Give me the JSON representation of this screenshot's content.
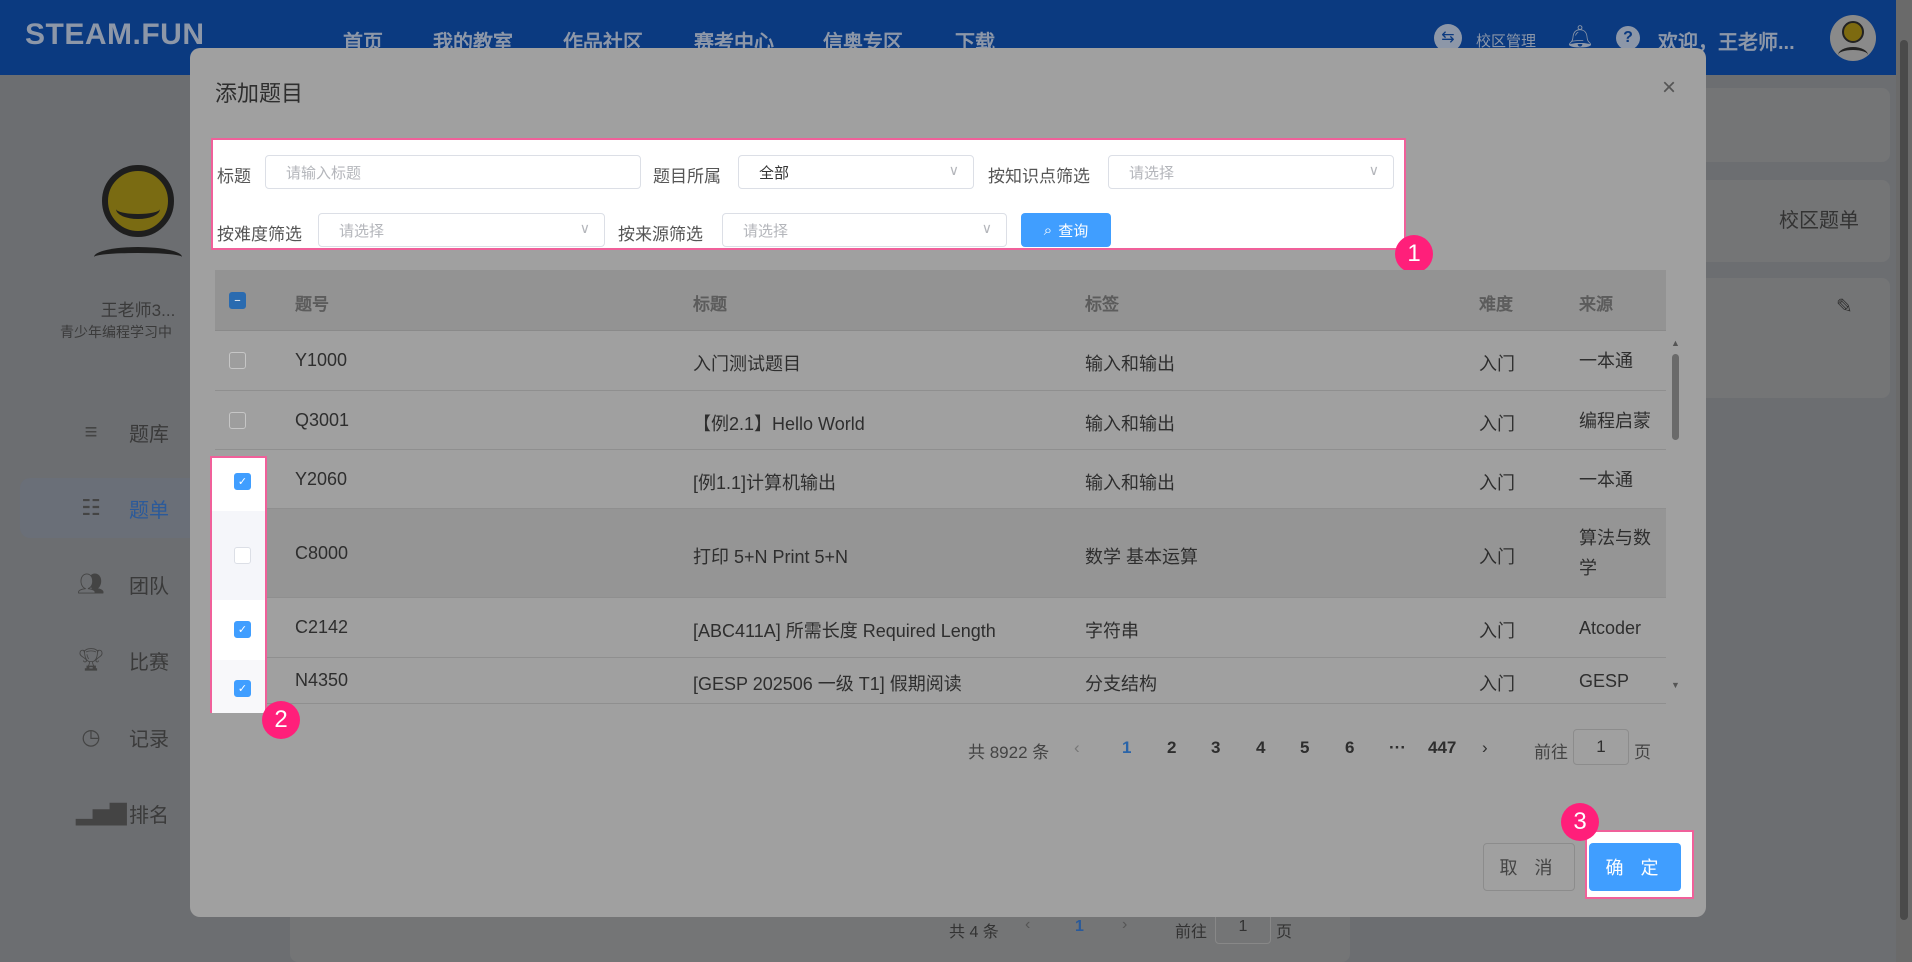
{
  "header": {
    "logo": "STEAM.FUN",
    "nav": [
      "首页",
      "我的教室",
      "作品社区",
      "赛考中心",
      "信奥专区",
      "下载"
    ],
    "campus_admin": "校区管理",
    "welcome": "欢迎，王老师..."
  },
  "sidebar": {
    "name": "王老师3...",
    "subtitle": "青少年编程学习中",
    "items": [
      {
        "label": "题库",
        "icon": "edit-list-icon"
      },
      {
        "label": "题单",
        "icon": "clipboard-list-icon"
      },
      {
        "label": "团队",
        "icon": "users-icon"
      },
      {
        "label": "比赛",
        "icon": "trophy-icon"
      },
      {
        "label": "记录",
        "icon": "clock-icon"
      },
      {
        "label": "排名",
        "icon": "bar-chart-icon"
      }
    ],
    "active": "题单"
  },
  "background": {
    "campus_list": "校区题单",
    "pagination": {
      "total": "共 4 条",
      "current": "1",
      "goto": "前往",
      "goto_value": "1",
      "page_suffix": "页"
    }
  },
  "modal": {
    "title": "添加题目",
    "filters": {
      "title_label": "标题",
      "title_placeholder": "请输入标题",
      "belong_label": "题目所属",
      "belong_value": "全部",
      "knowledge_label": "按知识点筛选",
      "knowledge_placeholder": "请选择",
      "difficulty_label": "按难度筛选",
      "difficulty_placeholder": "请选择",
      "source_label": "按来源筛选",
      "source_placeholder": "请选择",
      "search_button": "查询"
    },
    "table": {
      "columns": [
        "题号",
        "标题",
        "标签",
        "难度",
        "来源"
      ],
      "rows": [
        {
          "id": "Y1000",
          "title": "入门测试题目",
          "tags": "输入和输出",
          "difficulty": "入门",
          "source": "一本通",
          "checked": false
        },
        {
          "id": "Q3001",
          "title": "【例2.1】Hello World",
          "tags": "输入和输出",
          "difficulty": "入门",
          "source": "编程启蒙",
          "checked": false
        },
        {
          "id": "Y2060",
          "title": "[例1.1]计算机输出",
          "tags": "输入和输出",
          "difficulty": "入门",
          "source": "一本通",
          "checked": true
        },
        {
          "id": "C8000",
          "title": "打印 5+N Print 5+N",
          "tags": "数学 基本运算",
          "difficulty": "入门",
          "source": "算法与数学",
          "checked": false
        },
        {
          "id": "C2142",
          "title": "[ABC411A] 所需长度 Required Length",
          "tags": "字符串",
          "difficulty": "入门",
          "source": "Atcoder",
          "checked": true
        },
        {
          "id": "N4350",
          "title": "[GESP 202506 一级 T1] 假期阅读",
          "tags": "分支结构",
          "difficulty": "入门",
          "source": "GESP",
          "checked": true
        }
      ]
    },
    "pagination": {
      "total": "共 8922 条",
      "pages": [
        "1",
        "2",
        "3",
        "4",
        "5",
        "6",
        "···",
        "447"
      ],
      "current": "1",
      "goto": "前往",
      "goto_value": "1",
      "page_suffix": "页"
    },
    "cancel": "取 消",
    "confirm": "确 定"
  },
  "annotations": [
    "1",
    "2",
    "3"
  ],
  "colors": {
    "accent": "#409eff",
    "annotation": "#ff1f7a",
    "header": "#0b3a80"
  }
}
